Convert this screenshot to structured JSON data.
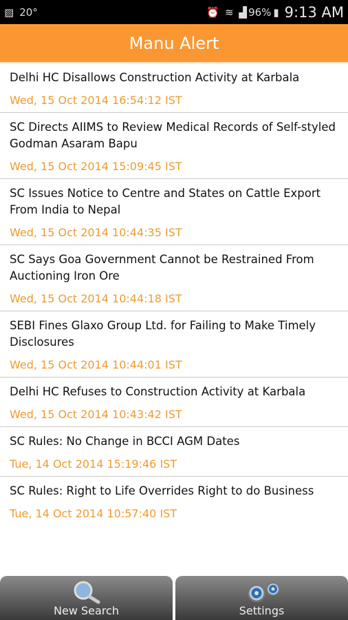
{
  "status_bar": {
    "temperature": "20°",
    "battery": "96%",
    "time": "9:13 AM"
  },
  "app": {
    "title": "Manu Alert"
  },
  "items": [
    {
      "title": "Delhi HC Disallows Construction Activity at Karbala",
      "date": "Wed, 15 Oct 2014 16:54:12 IST"
    },
    {
      "title": "SC Directs AIIMS to Review Medical Records of Self-styled Godman Asaram Bapu",
      "date": "Wed, 15 Oct 2014 15:09:45 IST"
    },
    {
      "title": "SC Issues Notice to Centre and States on Cattle Export From India to Nepal",
      "date": "Wed, 15 Oct 2014 10:44:35 IST"
    },
    {
      "title": "SC Says Goa Government Cannot be Restrained From Auctioning Iron Ore",
      "date": "Wed, 15 Oct 2014 10:44:18 IST"
    },
    {
      "title": "SEBI Fines Glaxo Group Ltd. for Failing to Make Timely Disclosures",
      "date": "Wed, 15 Oct 2014 10:44:01 IST"
    },
    {
      "title": "Delhi HC Refuses to Construction Activity at Karbala",
      "date": "Wed, 15 Oct 2014 10:43:42 IST"
    },
    {
      "title": "SC Rules: No Change in BCCI AGM Dates",
      "date": "Tue, 14 Oct 2014 15:19:46 IST"
    },
    {
      "title": "SC Rules: Right to Life Overrides Right to do Business",
      "date": "Tue, 14 Oct 2014 10:57:40 IST"
    }
  ],
  "bottom": {
    "new_search": "New Search",
    "settings": "Settings"
  },
  "colors": {
    "accent": "#fb9733",
    "date": "#f19a2e"
  }
}
